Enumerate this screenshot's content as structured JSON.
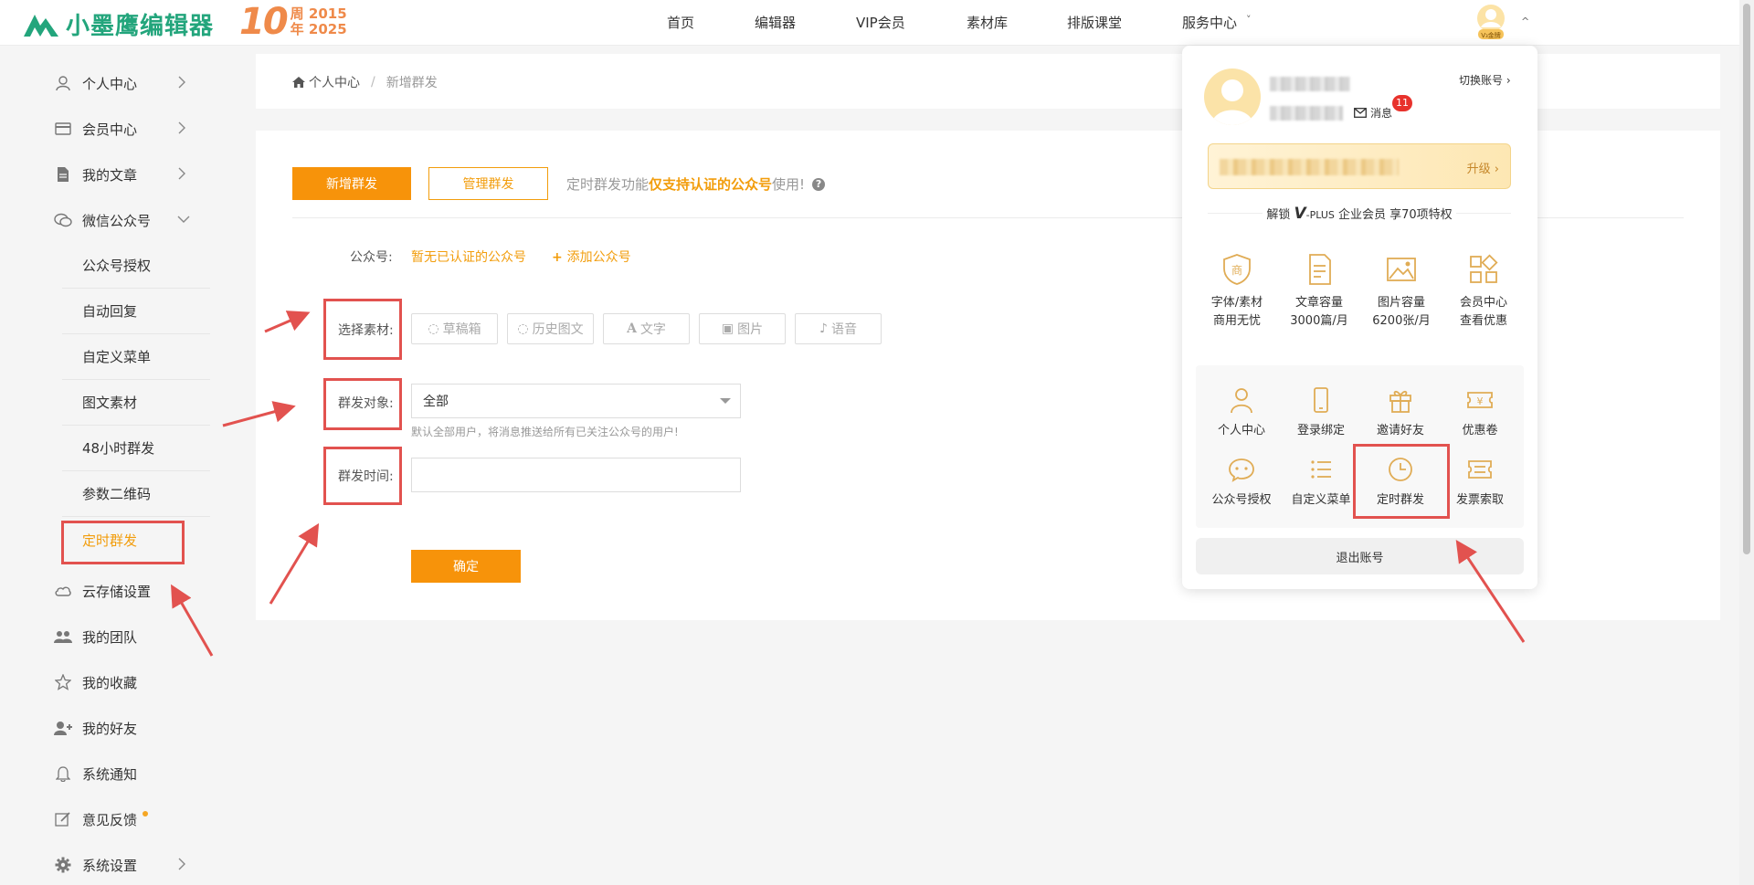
{
  "header": {
    "brand": "小墨鹰编辑器",
    "anniversary": {
      "number": "10",
      "line1_char": "周",
      "line1_year": "2015",
      "line2_char": "年",
      "line2_year": "2025"
    },
    "nav": [
      "首页",
      "编辑器",
      "VIP会员",
      "素材库",
      "排版课堂",
      "服务中心"
    ],
    "nav_dropdown_indicator": "˅",
    "avatar_badge": "V₃金牌"
  },
  "sidebar": {
    "items": [
      {
        "label": "个人中心",
        "icon": "user-icon",
        "chevron": "right"
      },
      {
        "label": "会员中心",
        "icon": "card-icon",
        "chevron": "right"
      },
      {
        "label": "我的文章",
        "icon": "document-icon",
        "chevron": "right"
      },
      {
        "label": "微信公众号",
        "icon": "wechat-icon",
        "chevron": "down"
      }
    ],
    "sub_items": [
      "公众号授权",
      "自动回复",
      "自定义菜单",
      "图文素材",
      "48小时群发",
      "参数二维码",
      "定时群发"
    ],
    "active_sub": "定时群发",
    "bottom_items": [
      {
        "label": "云存储设置",
        "icon": "cloud-icon"
      },
      {
        "label": "我的团队",
        "icon": "team-icon"
      },
      {
        "label": "我的收藏",
        "icon": "star-icon"
      },
      {
        "label": "我的好友",
        "icon": "add-friend-icon"
      },
      {
        "label": "系统通知",
        "icon": "bell-icon"
      },
      {
        "label": "意见反馈",
        "icon": "feedback-icon"
      },
      {
        "label": "系统设置",
        "icon": "gear-icon"
      }
    ]
  },
  "breadcrumb": {
    "home": "个人中心",
    "separator": "/",
    "current": "新增群发"
  },
  "toolbar": {
    "new_label": "新增群发",
    "manage_label": "管理群发",
    "notice_prefix": "定时群发功能",
    "notice_highlight": "仅支持认证的公众号",
    "notice_suffix": "使用!",
    "help": "?"
  },
  "form": {
    "account_label": "公众号:",
    "account_value": "暂无已认证的公众号",
    "add_account": "添加公众号",
    "material_label": "选择素材:",
    "materials": [
      {
        "label": "草稿箱",
        "icon": "chat-icon"
      },
      {
        "label": "历史图文",
        "icon": "chat-icon"
      },
      {
        "label": "文字",
        "icon": "font-icon"
      },
      {
        "label": "图片",
        "icon": "image-icon"
      },
      {
        "label": "语音",
        "icon": "mic-icon"
      }
    ],
    "target_label": "群发对象:",
    "target_value": "全部",
    "target_hint": "默认全部用户，将消息推送给所有已关注公众号的用户!",
    "time_label": "群发时间:",
    "time_value": "",
    "confirm": "确定"
  },
  "panel": {
    "switch_account": "切换账号 ›",
    "message": "消息",
    "message_count": "11",
    "upgrade": "升级 ›",
    "unlock": {
      "prefix": "解锁",
      "plus_logo": "V",
      "plus_text": "-PLUS",
      "suffix": "企业会员 享70项特权"
    },
    "perks": [
      {
        "icon": "shop-shield-icon",
        "glyph": "商",
        "line1": "字体/素材",
        "line2": "商用无忧"
      },
      {
        "icon": "article-icon",
        "line1": "文章容量",
        "line2": "3000篇/月"
      },
      {
        "icon": "picture-icon",
        "line1": "图片容量",
        "line2": "6200张/月"
      },
      {
        "icon": "apps-icon",
        "line1": "会员中心",
        "line2": "查看优惠"
      }
    ],
    "quick": [
      {
        "label": "个人中心",
        "icon": "person-icon"
      },
      {
        "label": "登录绑定",
        "icon": "phone-icon"
      },
      {
        "label": "邀请好友",
        "icon": "gift-icon"
      },
      {
        "label": "优惠卷",
        "icon": "coupon-icon",
        "glyph": "¥"
      },
      {
        "label": "公众号授权",
        "icon": "wechat-icon"
      },
      {
        "label": "自定义菜单",
        "icon": "list-icon"
      },
      {
        "label": "定时群发",
        "icon": "clock-icon"
      },
      {
        "label": "发票索取",
        "icon": "ticket-icon"
      }
    ],
    "logout": "退出账号"
  },
  "colors": {
    "accent": "#f7930a",
    "highlight_text": "#f29d0c",
    "brand_green": "#23a57c",
    "annotation_red": "#e2524f"
  }
}
